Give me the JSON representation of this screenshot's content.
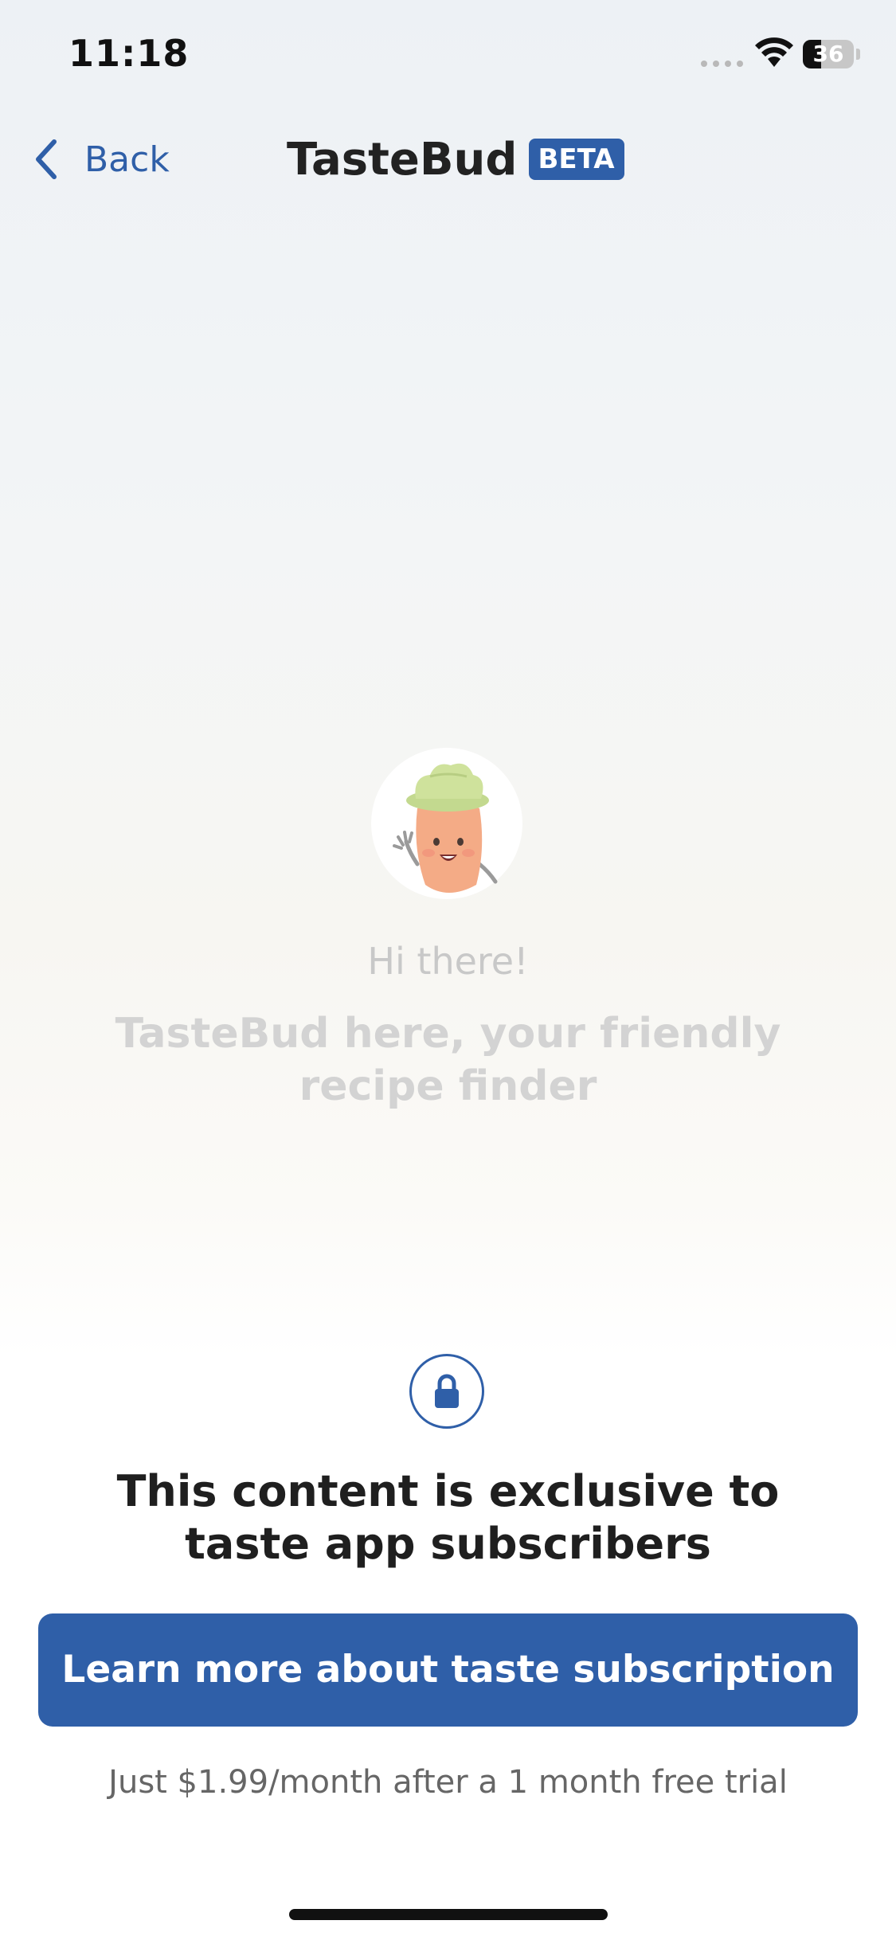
{
  "status_bar": {
    "time": "11:18",
    "battery_level": "36",
    "battery_fraction": 0.36
  },
  "nav": {
    "back_label": "Back",
    "title": "TasteBud",
    "badge": "BETA"
  },
  "mascot": {
    "icon": "carrot-chef-mascot",
    "greeting": "Hi there!",
    "intro": "TasteBud here, your friendly recipe finder"
  },
  "paywall": {
    "icon": "lock-icon",
    "title": "This content is exclusive to taste app subscribers",
    "button_label": "Learn more about taste subscription",
    "price_note": "Just $1.99/month after a 1 month free trial"
  },
  "colors": {
    "accent": "#2f5fa8",
    "title_text": "#1f1f1f",
    "faded_text": "#d3d3d3"
  }
}
